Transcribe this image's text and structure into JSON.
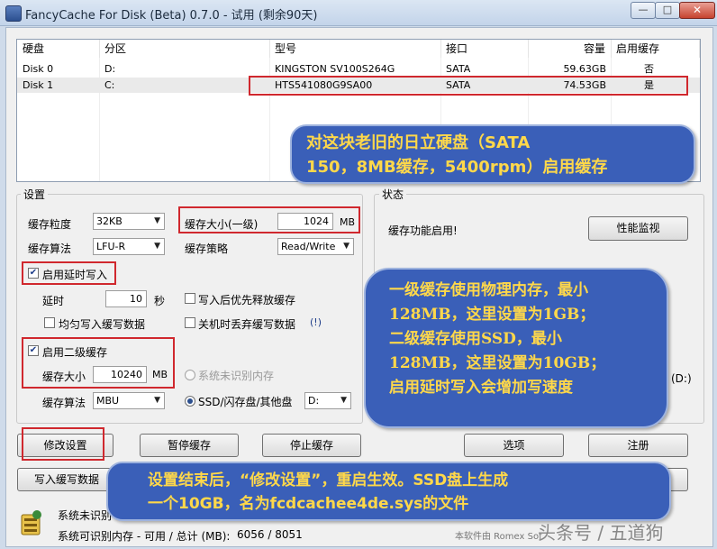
{
  "window": {
    "title": "FancyCache For Disk (Beta) 0.7.0 - 试用 (剩余90天)"
  },
  "disk_table": {
    "headers": [
      "硬盘",
      "分区",
      "型号",
      "接口",
      "容量",
      "启用缓存"
    ],
    "rows": [
      {
        "disk": "Disk 0",
        "partition": "D:",
        "model": "KINGSTON SV100S264G",
        "interface": "SATA",
        "capacity": "59.63GB",
        "enabled": "否"
      },
      {
        "disk": "Disk 1",
        "partition": "C:",
        "model": "HTS541080G9SA00",
        "interface": "SATA",
        "capacity": "74.53GB",
        "enabled": "是"
      }
    ]
  },
  "callouts": {
    "top": {
      "line1": "对这块老旧的日立硬盘（SATA",
      "line2": "150，8MB缓存，5400rpm）启用缓存"
    },
    "middle": {
      "lines": [
        "一级缓存使用物理内存，最小",
        "128MB，这里设置为1GB；",
        "二级缓存使用SSD，最小",
        "128MB，这里设置为10GB；",
        "启用延时写入会增加写速度"
      ]
    },
    "bottom": {
      "line1": "设置结束后，“修改设置”，重启生效。SSD盘上生成",
      "line2": "一个10GB，名为fcdcachee4de.sys的文件"
    }
  },
  "settings": {
    "group_label": "设置",
    "granularity_label": "缓存粒度",
    "granularity_value": "32KB",
    "algorithm_label": "缓存算法",
    "algorithm_value": "LFU-R",
    "cache_size_label": "缓存大小(一级)",
    "cache_size_value": "1024",
    "cache_size_unit": "MB",
    "strategy_label": "缓存策略",
    "strategy_value": "Read/Write",
    "delayed_write_label": "启用延时写入",
    "delay_label": "延时",
    "delay_value": "10",
    "delay_unit": "秒",
    "release_after_write_label": "写入后优先释放缓存",
    "even_write_label": "均匀写入缓写数据",
    "discard_on_shutdown_label": "关机时丢弃缓写数据",
    "discard_hint": "(!)",
    "l2_label": "启用二级缓存",
    "l2_size_label": "缓存大小",
    "l2_size_value": "10240",
    "l2_size_unit": "MB",
    "l2_algorithm_label": "缓存算法",
    "l2_algorithm_value": "MBU",
    "unrecognized_mem_label": "系统未识别内存",
    "ssd_label": "SSD/闪存盘/其他盘",
    "ssd_drive_value": "D:"
  },
  "status": {
    "group_label": "状态",
    "enabled_text": "缓存功能启用!",
    "monitor_button": "性能监视",
    "drive_hint": "(D:)"
  },
  "buttons": {
    "modify": "修改设置",
    "pause": "暂停缓存",
    "stop": "停止缓存",
    "options": "选项",
    "register": "注册",
    "write_data": "写入缓写数据"
  },
  "footer": {
    "unrecognized_prefix": "系统未识别",
    "memory_label": "系统可识别内存 - 可用 / 总计 (MB):",
    "memory_value": "6056 / 8051",
    "software_note": "本软件由 Romex Sof",
    "watermark": "头条号 / 五道狗"
  },
  "colors": {
    "callout_bg": "#3a5fb8",
    "callout_text": "#ffd84a",
    "highlight": "#d0282e"
  }
}
